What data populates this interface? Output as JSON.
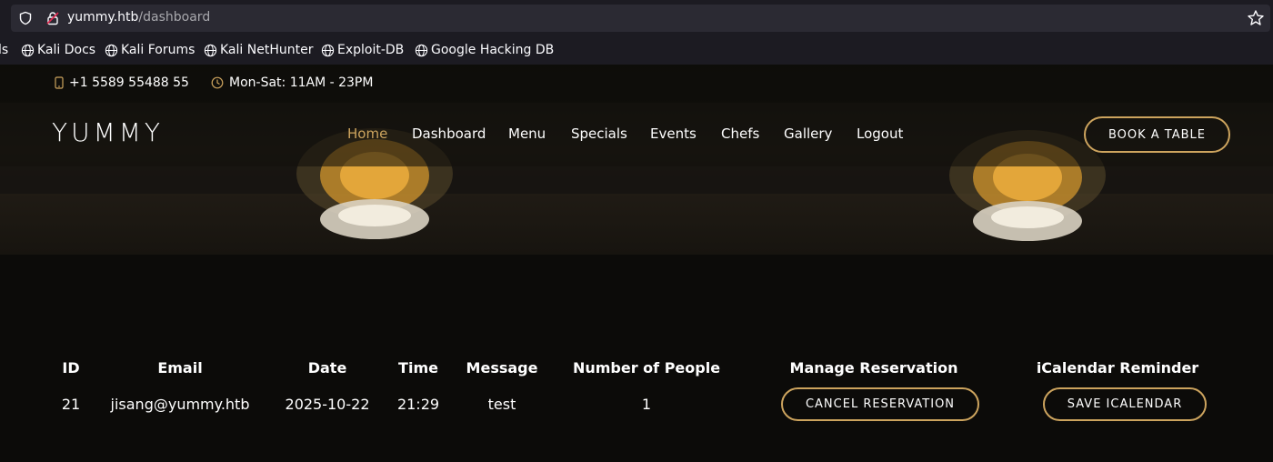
{
  "browser": {
    "url_host": "yummy.htb",
    "url_path": "/dashboard",
    "bookmarks": [
      {
        "label": "ls"
      },
      {
        "label": "Kali Docs"
      },
      {
        "label": "Kali Forums"
      },
      {
        "label": "Kali NetHunter"
      },
      {
        "label": "Exploit-DB"
      },
      {
        "label": "Google Hacking DB"
      }
    ]
  },
  "topbar": {
    "phone": "+1 5589 55488 55",
    "hours": "Mon-Sat: 11AM - 23PM"
  },
  "header": {
    "logo": "YUMMY",
    "nav": [
      "Home",
      "Dashboard",
      "Menu",
      "Specials",
      "Events",
      "Chefs",
      "Gallery",
      "Logout"
    ],
    "active": "Home",
    "book_button": "BOOK A TABLE"
  },
  "reservations": {
    "columns": [
      "ID",
      "Email",
      "Date",
      "Time",
      "Message",
      "Number of People",
      "Manage Reservation",
      "iCalendar Reminder"
    ],
    "rows": [
      {
        "id": "21",
        "email": "jisang@yummy.htb",
        "date": "2025-10-22",
        "time": "21:29",
        "message": "test",
        "people": "1",
        "cancel_label": "CANCEL RESERVATION",
        "ical_label": "SAVE ICALENDAR"
      }
    ]
  },
  "colors": {
    "accent": "#cda45e",
    "background": "#0c0b09"
  },
  "icons": [
    "shield-icon",
    "lock-icon",
    "star-icon",
    "globe-icon",
    "phone-icon",
    "clock-icon",
    "lamp-image"
  ]
}
